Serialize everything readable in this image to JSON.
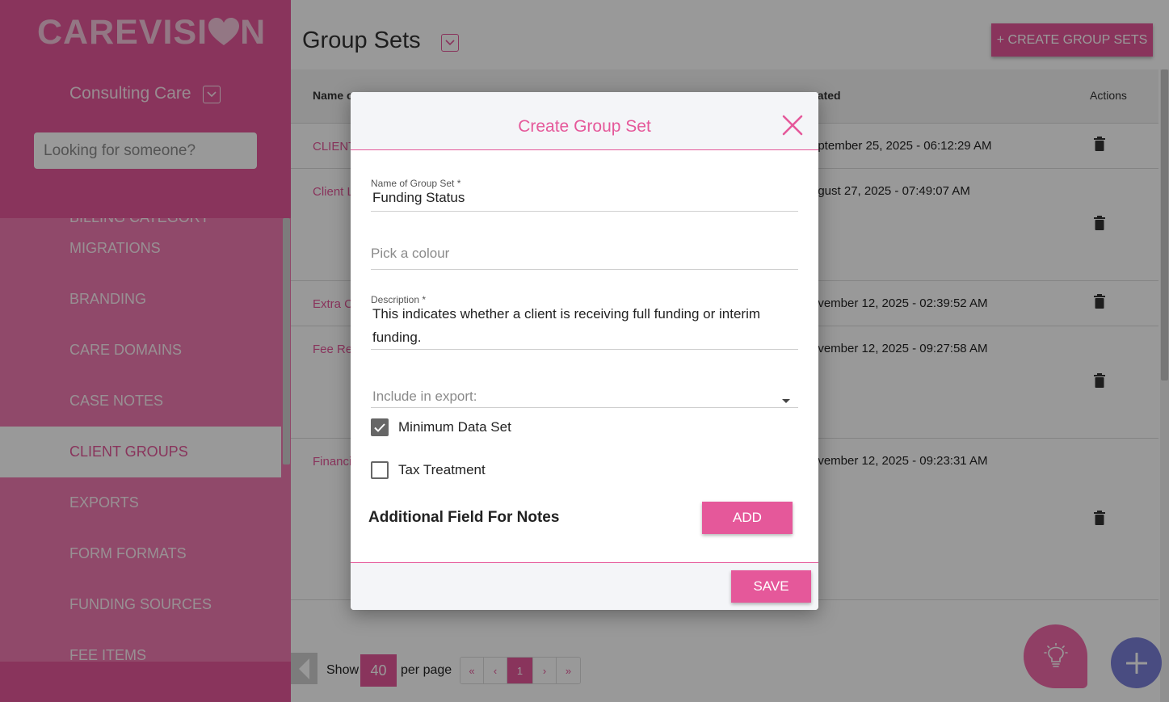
{
  "sidebar": {
    "logo_left": "CAREVISI",
    "logo_right": "N",
    "organization": "Consulting Care",
    "search_placeholder": "Looking for someone?",
    "menu_items": [
      {
        "label": "BILLING CATEGORY"
      },
      {
        "label": "MIGRATIONS"
      },
      {
        "label": "BRANDING"
      },
      {
        "label": "CARE DOMAINS"
      },
      {
        "label": "CASE NOTES"
      },
      {
        "label": "CLIENT GROUPS",
        "active": true
      },
      {
        "label": "EXPORTS"
      },
      {
        "label": "FORM FORMATS"
      },
      {
        "label": "FUNDING SOURCES"
      },
      {
        "label": "FEE ITEMS"
      }
    ]
  },
  "main": {
    "title": "Group Sets",
    "create_button": "+ CREATE GROUP SETS",
    "table": {
      "headers": {
        "name": "Name o",
        "created": "eated",
        "actions": "Actions"
      },
      "rows": [
        {
          "name": "CLIENT",
          "created": "eptember 25, 2025 - 06:12:29 AM"
        },
        {
          "name": "Client L",
          "created": "ugust 27, 2025 - 07:49:07 AM"
        },
        {
          "name": "Extra C",
          "created": "ovember 12, 2025 - 02:39:52 AM"
        },
        {
          "name": "Fee Re",
          "created": "ovember 12, 2025 - 09:27:58 AM"
        },
        {
          "name": "Financi",
          "created": "ovember 12, 2025 - 09:23:31 AM"
        }
      ]
    },
    "pagination": {
      "show_label": "Show",
      "per_page_value": "40",
      "per_page_label": "per page",
      "first": "«",
      "prev": "‹",
      "current_page": "1",
      "next": "›",
      "last": "»"
    }
  },
  "modal": {
    "title": "Create Group Set",
    "name_label": "Name of Group Set *",
    "name_value": "Funding Status",
    "colour_placeholder": "Pick a colour",
    "description_label": "Description *",
    "description_value": "This indicates whether a client is receiving full funding or interim funding.",
    "export_placeholder": "Include in export:",
    "checkboxes": [
      {
        "label": "Minimum Data Set",
        "checked": true
      },
      {
        "label": "Tax Treatment",
        "checked": false
      }
    ],
    "notes_label": "Additional Field For Notes",
    "add_button": "ADD",
    "save_button": "SAVE"
  },
  "colors": {
    "brand_pink": "#e5589a",
    "sidebar_menu": "#f07bb1",
    "fab_bulb": "#f06aa8",
    "fab_add": "#7b7fd8"
  }
}
